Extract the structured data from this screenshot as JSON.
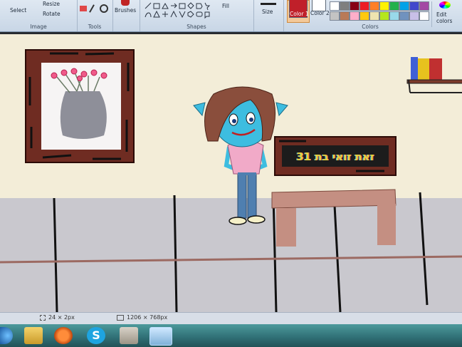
{
  "ribbon": {
    "image_group": {
      "select": "Select",
      "resize": "Resize",
      "rotate": "Rotate",
      "label": "Image"
    },
    "tools_group": {
      "label": "Tools"
    },
    "brushes": "Brushes",
    "shapes_group": {
      "fill": "Fill",
      "label": "Shapes"
    },
    "size": "Size",
    "color1": "Color 1",
    "color2": "Color 2",
    "colors_label": "Colors",
    "edit_colors": "Edit colors",
    "palette": [
      "#ffffff",
      "#7f7f7f",
      "#880015",
      "#ed1c24",
      "#ff7f27",
      "#fff200",
      "#22b14c",
      "#00a2e8",
      "#3f48cc",
      "#a349a4",
      "#c3c3c3",
      "#b97a57",
      "#ffaec9",
      "#ffc90e",
      "#efe4b0",
      "#b5e61d",
      "#99d9ea",
      "#7092be",
      "#c8bfe7",
      "#ffffff"
    ]
  },
  "drawing": {
    "sign_text": "זאת זואי בת 31"
  },
  "status": {
    "selection_size": "24 × 2px",
    "canvas_size": "1206 × 768px"
  },
  "colors": {
    "wall": "#f3edd8",
    "floor": "#c9c8ce",
    "wood": "#7b3a2a",
    "skin": "#3dbde0",
    "hair": "#8a4e3c",
    "shirt": "#f1aac8",
    "jeans": "#4f7fb0"
  }
}
